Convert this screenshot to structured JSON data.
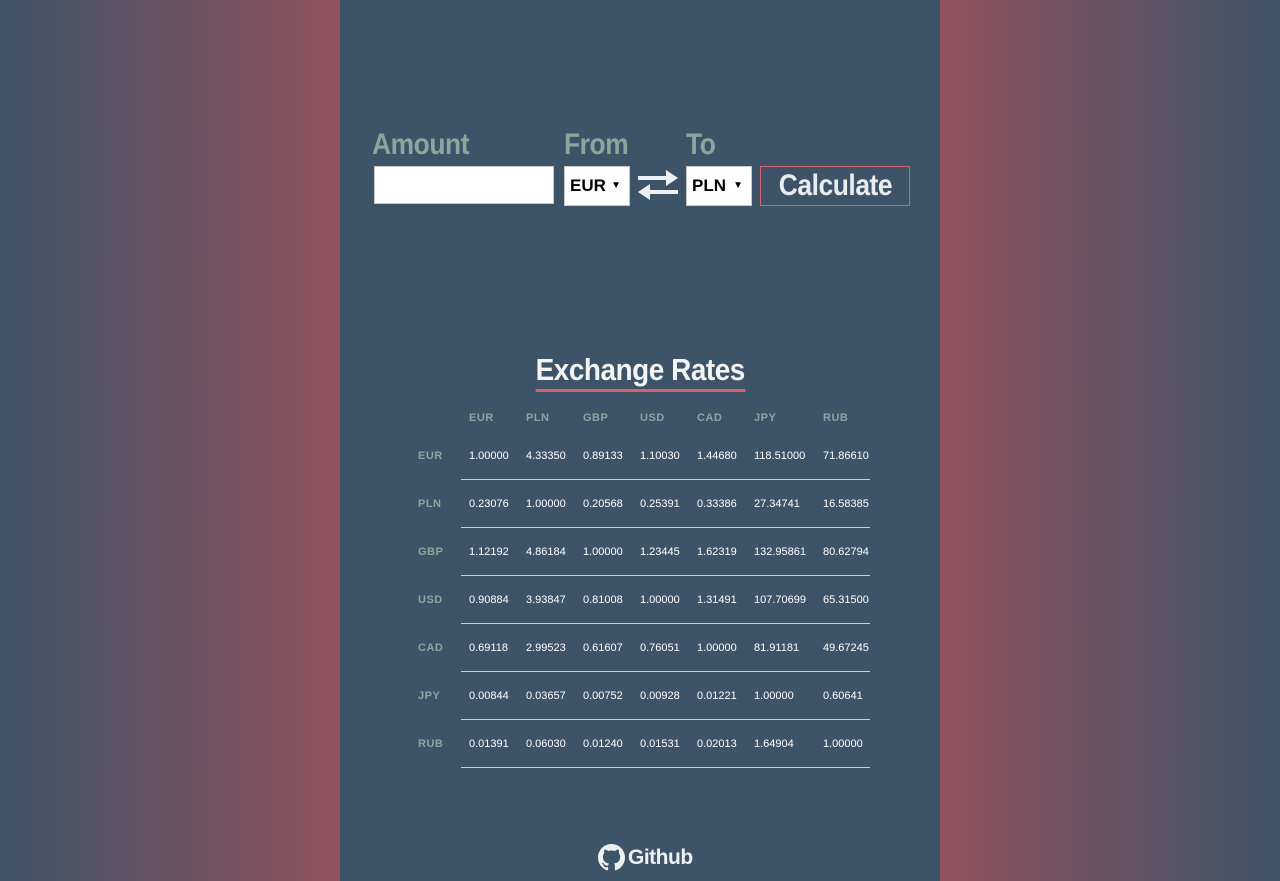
{
  "form": {
    "amount_label": "Amount",
    "from_label": "From",
    "to_label": "To",
    "amount_value": "",
    "from_value": "EUR",
    "to_value": "PLN",
    "calculate_label": "Calculate",
    "swap_icon": "swap-arrows-icon"
  },
  "rates": {
    "title": "Exchange Rates",
    "currencies": [
      "EUR",
      "PLN",
      "GBP",
      "USD",
      "CAD",
      "JPY",
      "RUB"
    ],
    "rows": [
      {
        "code": "EUR",
        "values": [
          "1.00000",
          "4.33350",
          "0.89133",
          "1.10030",
          "1.44680",
          "118.51000",
          "71.86610"
        ]
      },
      {
        "code": "PLN",
        "values": [
          "0.23076",
          "1.00000",
          "0.20568",
          "0.25391",
          "0.33386",
          "27.34741",
          "16.58385"
        ]
      },
      {
        "code": "GBP",
        "values": [
          "1.12192",
          "4.86184",
          "1.00000",
          "1.23445",
          "1.62319",
          "132.95861",
          "80.62794"
        ]
      },
      {
        "code": "USD",
        "values": [
          "0.90884",
          "3.93847",
          "0.81008",
          "1.00000",
          "1.31491",
          "107.70699",
          "65.31500"
        ]
      },
      {
        "code": "CAD",
        "values": [
          "0.69118",
          "2.99523",
          "0.61607",
          "0.76051",
          "1.00000",
          "81.91181",
          "49.67245"
        ]
      },
      {
        "code": "JPY",
        "values": [
          "0.00844",
          "0.03657",
          "0.00752",
          "0.00928",
          "0.01221",
          "1.00000",
          "0.60641"
        ]
      },
      {
        "code": "RUB",
        "values": [
          "0.01391",
          "0.06030",
          "0.01240",
          "0.01531",
          "0.02013",
          "1.64904",
          "1.00000"
        ]
      }
    ]
  },
  "footer": {
    "github_label": "Github",
    "github_icon": "github-icon"
  },
  "colors": {
    "label": "#8aa69e",
    "panel": "#3d5468",
    "accent": "#d8606a",
    "side_pink": "#92525e"
  }
}
